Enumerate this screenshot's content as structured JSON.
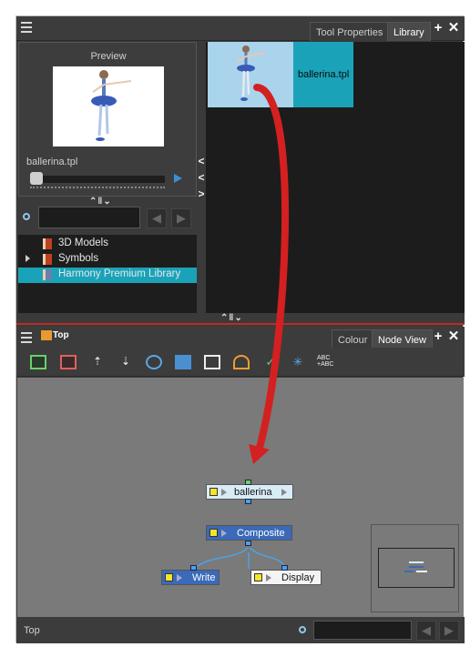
{
  "library_panel": {
    "tabs": [
      {
        "label": "Tool Properties",
        "active": false
      },
      {
        "label": "Library",
        "active": true
      }
    ],
    "preview": {
      "title": "Preview",
      "file_label": "ballerina.tpl"
    },
    "tree": [
      {
        "label": "3D Models",
        "icon": "book-icon",
        "expandable": false,
        "selected": false
      },
      {
        "label": "Symbols",
        "icon": "book-icon",
        "expandable": true,
        "selected": false
      },
      {
        "label": "Harmony Premium Library",
        "icon": "book-icon",
        "expandable": false,
        "selected": true
      }
    ],
    "library_item": {
      "name": "ballerina.tpl",
      "selected": true
    }
  },
  "node_view_panel": {
    "breadcrumb": "Top",
    "tabs": [
      {
        "label": "Colour",
        "active": false
      },
      {
        "label": "Node View",
        "active": true
      }
    ],
    "toolbar_icons": [
      "add-peg-icon",
      "add-drawing-icon",
      "move-up-icon",
      "move-down-icon",
      "camera-icon",
      "group-icon",
      "display-icon",
      "layer-icon",
      "enable-icon",
      "network-icon",
      "text-icon"
    ],
    "toolbar_text_icon_label": "ABC\n+ABC",
    "nodes": [
      {
        "label": "ballerina",
        "style": "selected"
      },
      {
        "label": "Composite",
        "style": "composite"
      },
      {
        "label": "Write",
        "style": "write"
      },
      {
        "label": "Display",
        "style": "display"
      }
    ],
    "status_label": "Top"
  },
  "colors": {
    "accent_cyan": "#1aa3b8",
    "drag_arrow": "#d42020",
    "port_blue": "#4aa3e8",
    "node_yellow": "#f5e42a"
  }
}
